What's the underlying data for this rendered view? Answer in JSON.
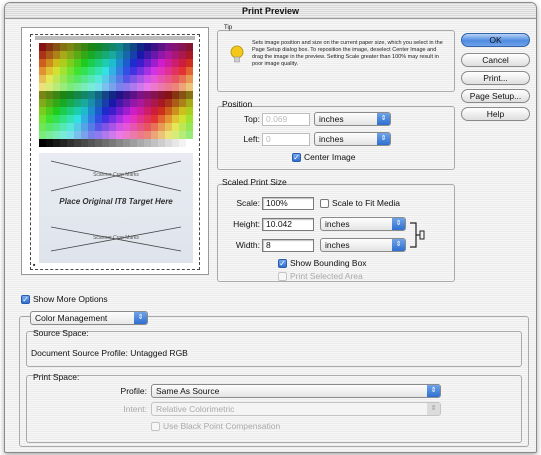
{
  "window": {
    "title": "Print Preview"
  },
  "preview": {
    "target_label": "Place Original IT8 Target Here",
    "crop_label_top": "Scanner Crop Marks",
    "crop_label_bottom": "Scanner Crop Marks"
  },
  "tip": {
    "title": "Tip",
    "text": "Sets image position and size on the current paper size, which you select in the Page Setup dialog box. To reposition the image, deselect Center Image and drag the image in the preview. Setting Scale greater than 100% may result in poor image quality."
  },
  "position": {
    "title": "Position",
    "top_label": "Top:",
    "top_value": "0.069",
    "top_unit": "inches",
    "left_label": "Left:",
    "left_value": "0",
    "left_unit": "inches",
    "center_image_label": "Center Image",
    "center_image_checked": true
  },
  "scaled": {
    "title": "Scaled Print Size",
    "scale_label": "Scale:",
    "scale_value": "100%",
    "scale_to_fit_label": "Scale to Fit Media",
    "height_label": "Height:",
    "height_value": "10.042",
    "height_unit": "inches",
    "width_label": "Width:",
    "width_value": "8",
    "width_unit": "inches",
    "show_bounding_box_label": "Show Bounding Box",
    "print_selected_area_label": "Print Selected Area"
  },
  "buttons": {
    "ok": "OK",
    "cancel": "Cancel",
    "print": "Print...",
    "page_setup": "Page Setup...",
    "help": "Help"
  },
  "show_more_options": {
    "label": "Show More Options",
    "checked": true
  },
  "color_management": {
    "popup_label": "Color Management",
    "source_space_title": "Source Space:",
    "document_source_profile": "Document Source Profile:  Untagged RGB",
    "print_space_title": "Print Space:",
    "profile_label": "Profile:",
    "profile_value": "Same As Source",
    "intent_label": "Intent:",
    "intent_value": "Relative Colorimetric",
    "black_point_label": "Use Black Point Compensation"
  },
  "colors": {
    "accent": "#2e6fd0",
    "tip_bulb": "#f2c81a"
  }
}
